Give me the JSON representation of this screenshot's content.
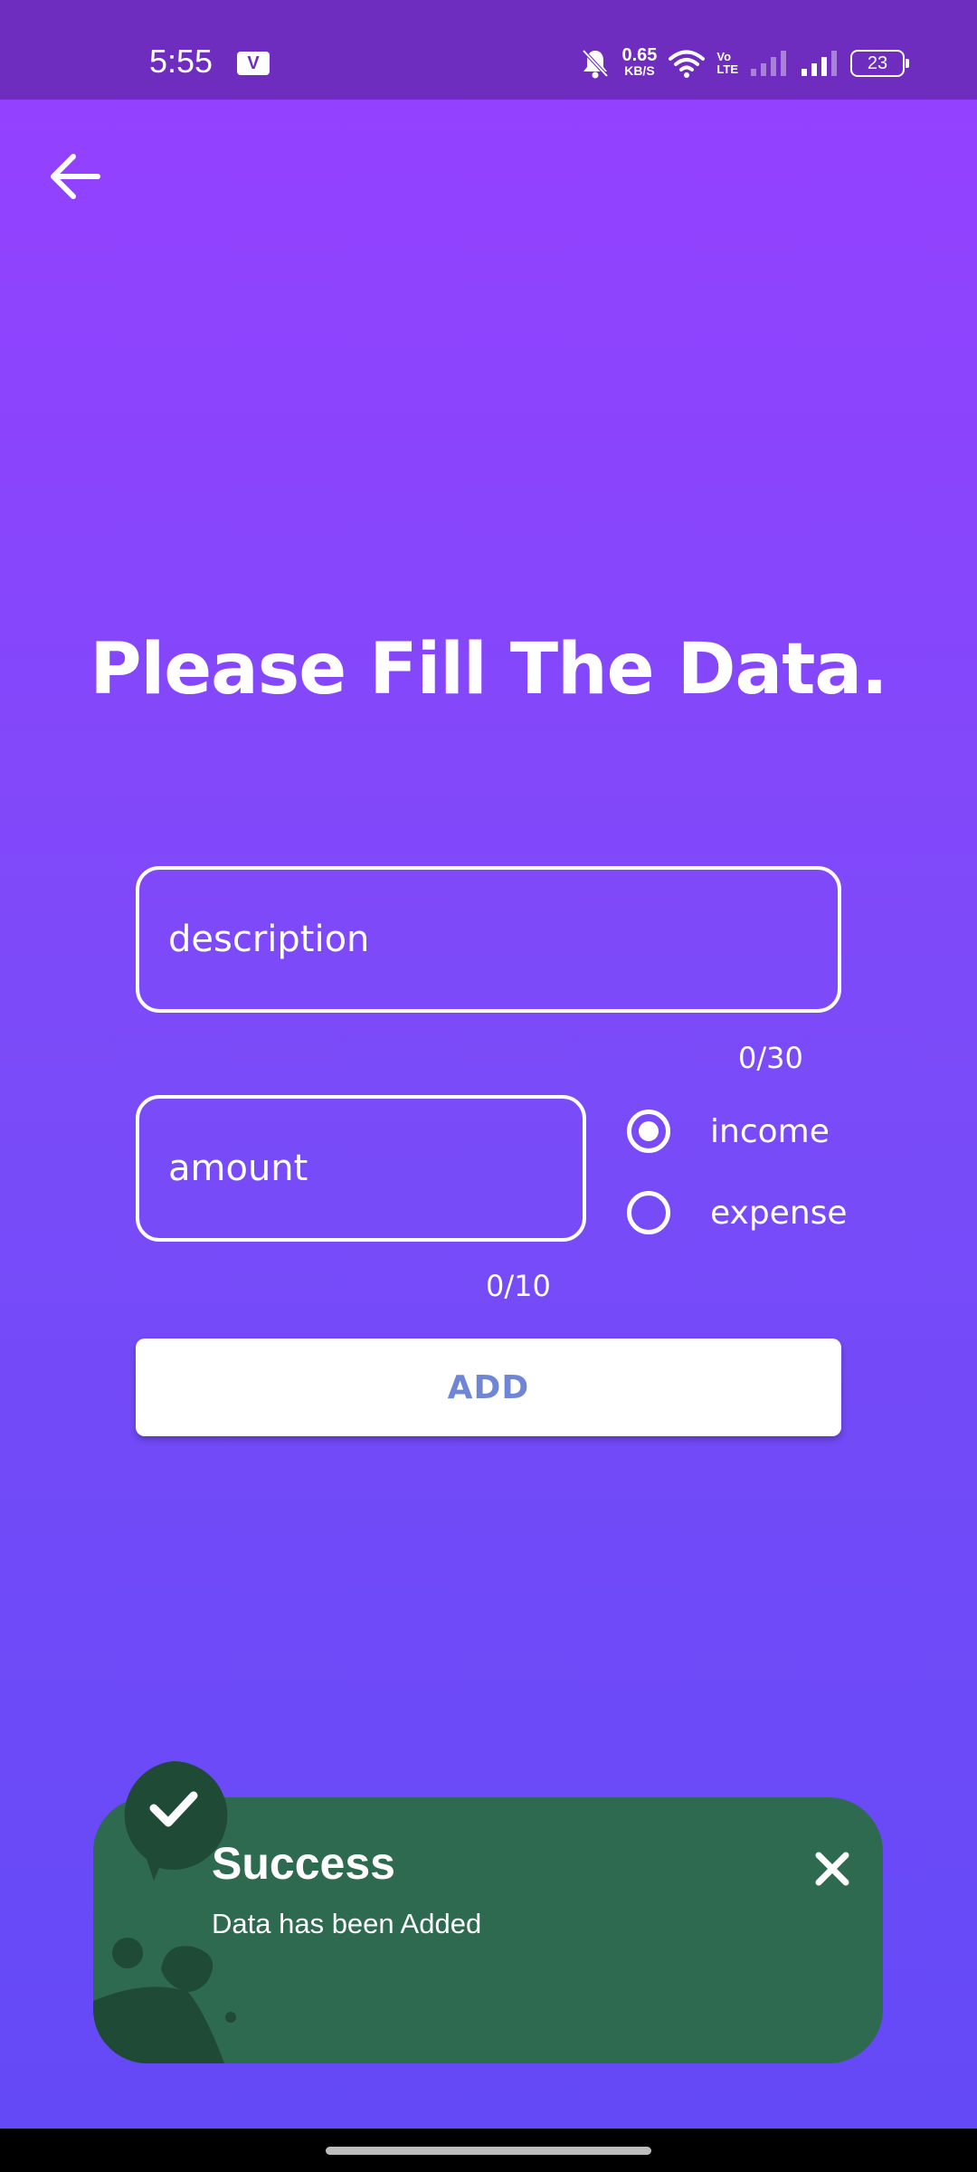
{
  "status_bar": {
    "time": "5:55",
    "net_speed_value": "0.65",
    "net_speed_unit": "KB/S",
    "volte_top": "Vo",
    "volte_bottom": "LTE",
    "battery": "23"
  },
  "form": {
    "title": "Please Fill The Data.",
    "description_placeholder": "description",
    "description_counter": "0/30",
    "amount_placeholder": "amount",
    "amount_counter": "0/10",
    "radio_options": [
      {
        "label": "income",
        "checked": true
      },
      {
        "label": "expense",
        "checked": false
      }
    ],
    "add_label": "ADD"
  },
  "snackbar": {
    "title": "Success",
    "message": "Data has been Added",
    "color": "#2E6A50"
  },
  "colors": {
    "background_top": "#9640FF",
    "background_bottom": "#6349F7",
    "status_bar": "#6E2DBF",
    "add_text": "#6F86D6"
  }
}
